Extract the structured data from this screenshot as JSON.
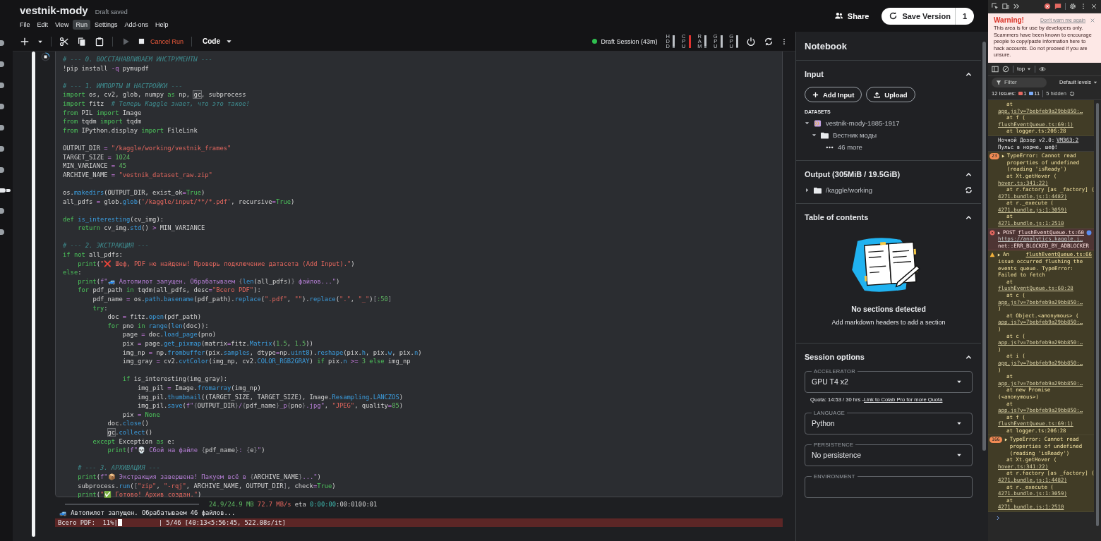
{
  "header": {
    "title": "vestnik-mody",
    "status": "Draft saved",
    "menu": [
      {
        "label": "File",
        "selected": false
      },
      {
        "label": "Edit",
        "selected": false
      },
      {
        "label": "View",
        "selected": false
      },
      {
        "label": "Run",
        "selected": true
      },
      {
        "label": "Settings",
        "selected": false
      },
      {
        "label": "Add-ons",
        "selected": false
      },
      {
        "label": "Help",
        "selected": false
      }
    ],
    "share": "Share",
    "save": "Save Version",
    "save_count": "1"
  },
  "rail": [
    {
      "selected": false
    },
    {
      "selected": false
    },
    {
      "selected": false
    },
    {
      "selected": false
    },
    {
      "selected": false
    },
    {
      "selected": false
    },
    {
      "selected": false
    },
    {
      "selected": true
    },
    {
      "selected": false
    },
    {
      "selected": false
    }
  ],
  "toolbar": {
    "cancel": "Cancel Run",
    "run_disabled": true,
    "cell_type": "Code",
    "session": "Draft Session (43m)",
    "meters": [
      {
        "label": "HDD",
        "level": 0.1
      },
      {
        "label": "CPU",
        "level": 0.95
      },
      {
        "label": "RAM",
        "level": 0.15
      },
      {
        "label": "GPU",
        "level": 0.05
      },
      {
        "label": "GPU",
        "level": 0.05
      }
    ]
  },
  "cell": {
    "running": true,
    "lines": [
      {
        "kind": "code",
        "tokens": [
          {
            "kind": "cm",
            "text": "# --- 0. ВОССТАНАВЛИВАЕМ ИНСТРУМЕНТЫ ---"
          }
        ]
      },
      {
        "kind": "code",
        "tokens": [
          {
            "kind": "pl",
            "text": "!pip install "
          },
          {
            "kind": "op",
            "text": "-q"
          },
          {
            "kind": "pl",
            "text": " pymupdf"
          }
        ]
      },
      {
        "kind": "blank"
      },
      {
        "kind": "code",
        "tokens": [
          {
            "kind": "cm",
            "text": "# --- 1. ИМПОРТЫ И НАСТРОЙКИ ---"
          }
        ]
      },
      {
        "kind": "code",
        "tokens": [
          {
            "kind": "kw",
            "text": "import"
          },
          {
            "kind": "pl",
            "text": " os, cv2, glob, numpy "
          },
          {
            "kind": "kw",
            "text": "as"
          },
          {
            "kind": "pl",
            "text": " np, "
          },
          {
            "kind": "hl",
            "text": "gc"
          },
          {
            "kind": "pl",
            "text": ", subprocess"
          }
        ]
      },
      {
        "kind": "code",
        "tokens": [
          {
            "kind": "kw",
            "text": "import"
          },
          {
            "kind": "pl",
            "text": " fitz  "
          },
          {
            "kind": "cm",
            "text": "# Теперь Kaggle знает, что это такое!"
          }
        ]
      },
      {
        "kind": "code",
        "tokens": [
          {
            "kind": "kw",
            "text": "from"
          },
          {
            "kind": "pl",
            "text": " PIL "
          },
          {
            "kind": "kw",
            "text": "import"
          },
          {
            "kind": "pl",
            "text": " Image"
          }
        ]
      },
      {
        "kind": "code",
        "tokens": [
          {
            "kind": "kw",
            "text": "from"
          },
          {
            "kind": "pl",
            "text": " tqdm "
          },
          {
            "kind": "kw",
            "text": "import"
          },
          {
            "kind": "pl",
            "text": " tqdm"
          }
        ]
      },
      {
        "kind": "code",
        "tokens": [
          {
            "kind": "kw",
            "text": "from"
          },
          {
            "kind": "pl",
            "text": " IPython.display "
          },
          {
            "kind": "kw",
            "text": "import"
          },
          {
            "kind": "pl",
            "text": " FileLink"
          }
        ]
      },
      {
        "kind": "blank"
      },
      {
        "kind": "code",
        "tokens": [
          {
            "kind": "pl",
            "text": "OUTPUT_DIR "
          },
          {
            "kind": "op",
            "text": "= "
          },
          {
            "kind": "str",
            "text": "\"/kaggle/working/vestnik_frames\""
          }
        ]
      },
      {
        "kind": "code",
        "tokens": [
          {
            "kind": "pl",
            "text": "TARGET_SIZE "
          },
          {
            "kind": "op",
            "text": "= "
          },
          {
            "kind": "num",
            "text": "1024"
          }
        ]
      },
      {
        "kind": "code",
        "tokens": [
          {
            "kind": "pl",
            "text": "MIN_VARIANCE "
          },
          {
            "kind": "op",
            "text": "= "
          },
          {
            "kind": "num",
            "text": "45"
          }
        ]
      },
      {
        "kind": "code",
        "tokens": [
          {
            "kind": "pl",
            "text": "ARCHIVE_NAME "
          },
          {
            "kind": "op",
            "text": "= "
          },
          {
            "kind": "str",
            "text": "\"vestnik_dataset_raw.zip\""
          }
        ]
      },
      {
        "kind": "blank"
      },
      {
        "kind": "code",
        "tokens": [
          {
            "kind": "pl",
            "text": "os."
          },
          {
            "kind": "fn",
            "text": "makedirs"
          },
          {
            "kind": "pl",
            "text": "(OUTPUT_DIR, exist_ok"
          },
          {
            "kind": "op",
            "text": "="
          },
          {
            "kind": "kw",
            "text": "True"
          },
          {
            "kind": "pl",
            "text": ")"
          }
        ]
      },
      {
        "kind": "code",
        "tokens": [
          {
            "kind": "pl",
            "text": "all_pdfs "
          },
          {
            "kind": "op",
            "text": "="
          },
          {
            "kind": "pl",
            "text": " glob."
          },
          {
            "kind": "fn",
            "text": "glob"
          },
          {
            "kind": "pl",
            "text": "("
          },
          {
            "kind": "str",
            "text": "'/kaggle/input/**/*.pdf'"
          },
          {
            "kind": "pl",
            "text": ", recursive"
          },
          {
            "kind": "op",
            "text": "="
          },
          {
            "kind": "kw",
            "text": "True"
          },
          {
            "kind": "pl",
            "text": ")"
          }
        ]
      },
      {
        "kind": "blank"
      },
      {
        "kind": "code",
        "tokens": [
          {
            "kind": "kw",
            "text": "def"
          },
          {
            "kind": "fn",
            "text": " is_interesting"
          },
          {
            "kind": "pl",
            "text": "(cv_img):"
          }
        ]
      },
      {
        "kind": "code",
        "tokens": [
          {
            "kind": "kw",
            "text": "    return"
          },
          {
            "kind": "pl",
            "text": " cv_img."
          },
          {
            "kind": "fn",
            "text": "std"
          },
          {
            "kind": "pl",
            "text": "() "
          },
          {
            "kind": "op",
            "text": ">"
          },
          {
            "kind": "pl",
            "text": " MIN_VARIANCE"
          }
        ]
      },
      {
        "kind": "blank"
      },
      {
        "kind": "code",
        "tokens": [
          {
            "kind": "cm",
            "text": "# --- 2. ЭКСТРАКЦИЯ ---"
          }
        ]
      },
      {
        "kind": "code",
        "tokens": [
          {
            "kind": "kw",
            "text": "if not"
          },
          {
            "kind": "pl",
            "text": " all_pdfs:"
          }
        ]
      },
      {
        "kind": "code",
        "tokens": [
          {
            "kind": "kw",
            "text": "    print"
          },
          {
            "kind": "pl",
            "text": "("
          },
          {
            "kind": "str",
            "text": "\"❌ Шеф, PDF не найдены! Проверь подключение датасета (Add Input).\""
          },
          {
            "kind": "pl",
            "text": ")"
          }
        ]
      },
      {
        "kind": "code",
        "tokens": [
          {
            "kind": "kw",
            "text": "else"
          },
          {
            "kind": "pl",
            "text": ":"
          }
        ]
      },
      {
        "kind": "code",
        "tokens": [
          {
            "kind": "kw",
            "text": "    print"
          },
          {
            "kind": "pl",
            "text": "("
          },
          {
            "kind": "fs",
            "text": "f\"🚙 Автопилот запущен. Обрабатываем "
          },
          {
            "kind": "br",
            "text": "{"
          },
          {
            "kind": "fn",
            "text": "len"
          },
          {
            "kind": "pl",
            "text": "(all_pdfs)"
          },
          {
            "kind": "br",
            "text": "}"
          },
          {
            "kind": "fs",
            "text": " файлов...\""
          },
          {
            "kind": "pl",
            "text": ")"
          }
        ]
      },
      {
        "kind": "code",
        "tokens": [
          {
            "kind": "kw",
            "text": "    for"
          },
          {
            "kind": "pl",
            "text": " pdf_path "
          },
          {
            "kind": "kw",
            "text": "in"
          },
          {
            "kind": "pl",
            "text": " tqdm(all_pdfs, desc"
          },
          {
            "kind": "op",
            "text": "="
          },
          {
            "kind": "str",
            "text": "\"Всего PDF\""
          },
          {
            "kind": "pl",
            "text": "):"
          }
        ]
      },
      {
        "kind": "code",
        "tokens": [
          {
            "kind": "pl",
            "text": "        pdf_name "
          },
          {
            "kind": "op",
            "text": "="
          },
          {
            "kind": "pl",
            "text": " os."
          },
          {
            "kind": "fn",
            "text": "path"
          },
          {
            "kind": "pl",
            "text": "."
          },
          {
            "kind": "fn",
            "text": "basename"
          },
          {
            "kind": "pl",
            "text": "(pdf_path)."
          },
          {
            "kind": "fn",
            "text": "replace"
          },
          {
            "kind": "pl",
            "text": "("
          },
          {
            "kind": "str",
            "text": "\".pdf\""
          },
          {
            "kind": "pl",
            "text": ", "
          },
          {
            "kind": "str",
            "text": "\"\""
          },
          {
            "kind": "pl",
            "text": ")."
          },
          {
            "kind": "fn",
            "text": "replace"
          },
          {
            "kind": "pl",
            "text": "("
          },
          {
            "kind": "str",
            "text": "\".\""
          },
          {
            "kind": "pl",
            "text": ", "
          },
          {
            "kind": "str",
            "text": "\"_\""
          },
          {
            "kind": "pl",
            "text": ")"
          },
          {
            "kind": "br",
            "text": "["
          },
          {
            "kind": "num",
            "text": ":50"
          },
          {
            "kind": "br",
            "text": "]"
          }
        ]
      },
      {
        "kind": "code",
        "tokens": [
          {
            "kind": "kw",
            "text": "        try"
          },
          {
            "kind": "pl",
            "text": ":"
          }
        ]
      },
      {
        "kind": "code",
        "tokens": [
          {
            "kind": "pl",
            "text": "            doc "
          },
          {
            "kind": "op",
            "text": "="
          },
          {
            "kind": "pl",
            "text": " fitz."
          },
          {
            "kind": "fn",
            "text": "open"
          },
          {
            "kind": "pl",
            "text": "(pdf_path)"
          }
        ]
      },
      {
        "kind": "code",
        "tokens": [
          {
            "kind": "kw",
            "text": "            for"
          },
          {
            "kind": "pl",
            "text": " pno "
          },
          {
            "kind": "kw",
            "text": "in"
          },
          {
            "kind": "fn",
            "text": " range"
          },
          {
            "kind": "pl",
            "text": "("
          },
          {
            "kind": "fn",
            "text": "len"
          },
          {
            "kind": "pl",
            "text": "(doc)):"
          }
        ]
      },
      {
        "kind": "code",
        "tokens": [
          {
            "kind": "pl",
            "text": "                page "
          },
          {
            "kind": "op",
            "text": "="
          },
          {
            "kind": "pl",
            "text": " doc."
          },
          {
            "kind": "fn",
            "text": "load_page"
          },
          {
            "kind": "pl",
            "text": "(pno)"
          }
        ]
      },
      {
        "kind": "code",
        "tokens": [
          {
            "kind": "pl",
            "text": "                pix "
          },
          {
            "kind": "op",
            "text": "="
          },
          {
            "kind": "pl",
            "text": " page."
          },
          {
            "kind": "fn",
            "text": "get_pixmap"
          },
          {
            "kind": "pl",
            "text": "(matrix"
          },
          {
            "kind": "op",
            "text": "="
          },
          {
            "kind": "pl",
            "text": "fitz."
          },
          {
            "kind": "fn",
            "text": "Matrix"
          },
          {
            "kind": "pl",
            "text": "("
          },
          {
            "kind": "num",
            "text": "1.5"
          },
          {
            "kind": "pl",
            "text": ", "
          },
          {
            "kind": "num",
            "text": "1.5"
          },
          {
            "kind": "pl",
            "text": "))"
          }
        ]
      },
      {
        "kind": "code",
        "tokens": [
          {
            "kind": "pl",
            "text": "                img_np "
          },
          {
            "kind": "op",
            "text": "="
          },
          {
            "kind": "pl",
            "text": " np."
          },
          {
            "kind": "fn",
            "text": "frombuffer"
          },
          {
            "kind": "pl",
            "text": "(pix."
          },
          {
            "kind": "fn",
            "text": "samples"
          },
          {
            "kind": "pl",
            "text": ", dtype"
          },
          {
            "kind": "op",
            "text": "="
          },
          {
            "kind": "pl",
            "text": "np."
          },
          {
            "kind": "fn",
            "text": "uint8"
          },
          {
            "kind": "pl",
            "text": ")."
          },
          {
            "kind": "fn",
            "text": "reshape"
          },
          {
            "kind": "pl",
            "text": "(pix."
          },
          {
            "kind": "fn",
            "text": "h"
          },
          {
            "kind": "pl",
            "text": ", pix."
          },
          {
            "kind": "fn",
            "text": "w"
          },
          {
            "kind": "pl",
            "text": ", pix."
          },
          {
            "kind": "fn",
            "text": "n"
          },
          {
            "kind": "pl",
            "text": ")"
          }
        ]
      },
      {
        "kind": "code",
        "tokens": [
          {
            "kind": "pl",
            "text": "                img_gray "
          },
          {
            "kind": "op",
            "text": "="
          },
          {
            "kind": "pl",
            "text": " cv2."
          },
          {
            "kind": "fn",
            "text": "cvtColor"
          },
          {
            "kind": "pl",
            "text": "(img_np, cv2."
          },
          {
            "kind": "fn",
            "text": "COLOR_RGB2GRAY"
          },
          {
            "kind": "pl",
            "text": ") "
          },
          {
            "kind": "kw",
            "text": "if"
          },
          {
            "kind": "pl",
            "text": " pix."
          },
          {
            "kind": "fn",
            "text": "n"
          },
          {
            "kind": "op",
            "text": " >= "
          },
          {
            "kind": "num",
            "text": "3"
          },
          {
            "kind": "kw",
            "text": " else"
          },
          {
            "kind": "pl",
            "text": " img_np"
          }
        ]
      },
      {
        "kind": "blank"
      },
      {
        "kind": "code",
        "tokens": [
          {
            "kind": "kw",
            "text": "                if"
          },
          {
            "kind": "pl",
            "text": " is_interesting(img_gray):"
          }
        ]
      },
      {
        "kind": "code",
        "tokens": [
          {
            "kind": "pl",
            "text": "                    img_pil "
          },
          {
            "kind": "op",
            "text": "="
          },
          {
            "kind": "pl",
            "text": " Image."
          },
          {
            "kind": "fn",
            "text": "fromarray"
          },
          {
            "kind": "pl",
            "text": "(img_np)"
          }
        ]
      },
      {
        "kind": "code",
        "tokens": [
          {
            "kind": "pl",
            "text": "                    img_pil."
          },
          {
            "kind": "fn",
            "text": "thumbnail"
          },
          {
            "kind": "pl",
            "text": "((TARGET_SIZE, TARGET_SIZE), Image."
          },
          {
            "kind": "fn",
            "text": "Resampling"
          },
          {
            "kind": "pl",
            "text": "."
          },
          {
            "kind": "fn",
            "text": "LANCZOS"
          },
          {
            "kind": "pl",
            "text": ")"
          }
        ]
      },
      {
        "kind": "code",
        "tokens": [
          {
            "kind": "pl",
            "text": "                    img_pil."
          },
          {
            "kind": "fn",
            "text": "save"
          },
          {
            "kind": "pl",
            "text": "("
          },
          {
            "kind": "fs",
            "text": "f\""
          },
          {
            "kind": "br",
            "text": "{"
          },
          {
            "kind": "pl",
            "text": "OUTPUT_DIR"
          },
          {
            "kind": "br",
            "text": "}"
          },
          {
            "kind": "fs",
            "text": "/"
          },
          {
            "kind": "br",
            "text": "{"
          },
          {
            "kind": "pl",
            "text": "pdf_name"
          },
          {
            "kind": "br",
            "text": "}"
          },
          {
            "kind": "fs",
            "text": "_p"
          },
          {
            "kind": "br",
            "text": "{"
          },
          {
            "kind": "pl",
            "text": "pno"
          },
          {
            "kind": "br",
            "text": "}"
          },
          {
            "kind": "fs",
            "text": ".jpg\""
          },
          {
            "kind": "pl",
            "text": ", "
          },
          {
            "kind": "str",
            "text": "\"JPEG\""
          },
          {
            "kind": "pl",
            "text": ", quality"
          },
          {
            "kind": "op",
            "text": "="
          },
          {
            "kind": "num",
            "text": "85"
          },
          {
            "kind": "pl",
            "text": ")"
          }
        ]
      },
      {
        "kind": "code",
        "tokens": [
          {
            "kind": "pl",
            "text": "                pix "
          },
          {
            "kind": "op",
            "text": "= "
          },
          {
            "kind": "kw",
            "text": "None"
          }
        ]
      },
      {
        "kind": "code",
        "tokens": [
          {
            "kind": "pl",
            "text": "            doc."
          },
          {
            "kind": "fn",
            "text": "close"
          },
          {
            "kind": "pl",
            "text": "()"
          }
        ]
      },
      {
        "kind": "code",
        "tokens": [
          {
            "kind": "hl",
            "text": "            gc"
          },
          {
            "kind": "pl",
            "text": "."
          },
          {
            "kind": "fn",
            "text": "collect"
          },
          {
            "kind": "pl",
            "text": "()"
          }
        ]
      },
      {
        "kind": "code",
        "tokens": [
          {
            "kind": "kw",
            "text": "        except"
          },
          {
            "kind": "pl",
            "text": " Exception "
          },
          {
            "kind": "kw",
            "text": "as"
          },
          {
            "kind": "pl",
            "text": " e:"
          }
        ]
      },
      {
        "kind": "code",
        "tokens": [
          {
            "kind": "kw",
            "text": "            print"
          },
          {
            "kind": "pl",
            "text": "("
          },
          {
            "kind": "fs",
            "text": "f\"💀 Сбой на файле "
          },
          {
            "kind": "br",
            "text": "{"
          },
          {
            "kind": "pl",
            "text": "pdf_name"
          },
          {
            "kind": "br",
            "text": "}"
          },
          {
            "kind": "fs",
            "text": ": "
          },
          {
            "kind": "br",
            "text": "{"
          },
          {
            "kind": "pl",
            "text": "e"
          },
          {
            "kind": "br",
            "text": "}"
          },
          {
            "kind": "fs",
            "text": "\""
          },
          {
            "kind": "pl",
            "text": ")"
          }
        ]
      },
      {
        "kind": "blank"
      },
      {
        "kind": "code",
        "tokens": [
          {
            "kind": "cm",
            "text": "    # --- 3. АРХИВАЦИЯ ---"
          }
        ]
      },
      {
        "kind": "code",
        "tokens": [
          {
            "kind": "kw",
            "text": "    print"
          },
          {
            "kind": "pl",
            "text": "("
          },
          {
            "kind": "fs",
            "text": "f\"📦 Экстракция завершена! Пакуем всё в "
          },
          {
            "kind": "br",
            "text": "{"
          },
          {
            "kind": "pl",
            "text": "ARCHIVE_NAME"
          },
          {
            "kind": "br",
            "text": "}"
          },
          {
            "kind": "fs",
            "text": "...\""
          },
          {
            "kind": "pl",
            "text": ")"
          }
        ]
      },
      {
        "kind": "code",
        "tokens": [
          {
            "kind": "pl",
            "text": "    subprocess."
          },
          {
            "kind": "fn",
            "text": "run"
          },
          {
            "kind": "pl",
            "text": "("
          },
          {
            "kind": "br",
            "text": "["
          },
          {
            "kind": "str",
            "text": "\"zip\""
          },
          {
            "kind": "pl",
            "text": ", "
          },
          {
            "kind": "str",
            "text": "\"-rqj\""
          },
          {
            "kind": "pl",
            "text": ", ARCHIVE_NAME, OUTPUT_DIR"
          },
          {
            "kind": "br",
            "text": "]"
          },
          {
            "kind": "pl",
            "text": ", check"
          },
          {
            "kind": "op",
            "text": "="
          },
          {
            "kind": "kw",
            "text": "True"
          },
          {
            "kind": "pl",
            "text": ")"
          }
        ]
      },
      {
        "kind": "code",
        "tokens": [
          {
            "kind": "kw",
            "text": "    print"
          },
          {
            "kind": "pl",
            "text": "("
          },
          {
            "kind": "str",
            "text": "\"✅ Готово! Архив создан.\""
          },
          {
            "kind": "pl",
            "text": ")"
          }
        ]
      }
    ],
    "output": {
      "download": {
        "level": 1.0,
        "tokens": [
          {
            "kind": "size",
            "text": "24.9/24.9 MB"
          },
          {
            "kind": "speed",
            "text": " 72.7 MB/s"
          },
          {
            "kind": "pl",
            "text": " eta "
          },
          {
            "kind": "eta",
            "text": "0:00:00"
          },
          {
            "kind": "pl",
            "text": ":00:0100:01"
          }
        ]
      },
      "log": "🚙 Автопилот запущен. Обрабатываем 46 файлов...",
      "progress": {
        "prefix": "Всего PDF:  11%|",
        "level": 0.11,
        "suffix": "| 5/46 [40:13<5:56:45, 522.08s/it]"
      }
    }
  },
  "panel": {
    "title": "Notebook",
    "input": {
      "title": "Input",
      "expanded": true,
      "buttons": [
        "Add Input",
        "Upload"
      ],
      "datasets_label": "DATASETS",
      "tree": [
        {
          "label": "vestnik-mody-1885-1917",
          "kind": "dataset",
          "expanded": true,
          "children": [
            {
              "label": "Вестник моды",
              "kind": "folder",
              "expanded": true,
              "children": [
                {
                  "label": "46 more",
                  "kind": "more"
                }
              ]
            }
          ]
        }
      ]
    },
    "output": {
      "title": "Output (305MiB / 19.5GiB)",
      "expanded": true,
      "tree": [
        {
          "label": "/kaggle/working",
          "kind": "folder",
          "expanded": false
        }
      ]
    },
    "toc": {
      "title": "Table of contents",
      "expanded": true,
      "empty_title": "No sections detected",
      "empty_text": "Add markdown headers to add a section"
    },
    "session": {
      "title": "Session options",
      "expanded": true,
      "fields": [
        {
          "label": "ACCELERATOR",
          "value": "GPU T4 x2",
          "note": "Quota: 14:53 / 30 hrs - ",
          "note_link": "Link to Colab Pro for more Quota"
        },
        {
          "label": "LANGUAGE",
          "value": "Python"
        },
        {
          "label": "PERSISTENCE",
          "value": "No persistence"
        },
        {
          "label": "ENVIRONMENT"
        }
      ]
    }
  },
  "devtools": {
    "warning": {
      "title": "Warning!",
      "dismiss": "Don't warn me again",
      "text": "This area is for use by developers only. Scammers have been known to encourage people to copy/paste information here to hack accounts. Do not proceed if you are unsure."
    },
    "context": "top",
    "filter_placeholder": "Filter",
    "levels": "Default levels",
    "issues": {
      "label": "12 Issues:",
      "errors": "1",
      "infos": "11",
      "hidden": "5 hidden"
    },
    "messages": [
      {
        "kind": "warning",
        "lines": [
          {
            "kind": "at",
            "text": "at"
          },
          {
            "kind": "link",
            "text": "app.js?v=7bebfeb9a29bb850:…"
          },
          {
            "kind": "at",
            "text": "at f ("
          },
          {
            "kind": "link",
            "text": "flushEventQueue.ts:69:1)"
          },
          {
            "kind": "at",
            "text": "at logger.ts:206:28"
          }
        ]
      },
      {
        "kind": "info",
        "head": "Ночной Дозор v2.0:",
        "source": "VM363:2",
        "text": "Пульс в норме, шеф!"
      },
      {
        "kind": "warning",
        "count": "23",
        "head": "TypeError: Cannot read properties of undefined (reading 'isReady')",
        "lines": [
          {
            "kind": "at",
            "text": "at Xt.getHover ("
          },
          {
            "kind": "link",
            "text": "hover.ts:341:22)"
          },
          {
            "kind": "at",
            "text": "at r.factory [as _factory] ("
          },
          {
            "kind": "link",
            "text": "4271.bundle.js:1:4482)"
          },
          {
            "kind": "at",
            "text": "at r._execute ("
          },
          {
            "kind": "link",
            "text": "4271.bundle.js:1:3059)"
          },
          {
            "kind": "at",
            "text": "at"
          },
          {
            "kind": "link",
            "text": "4271.bundle.js:1:2510"
          }
        ]
      },
      {
        "kind": "error",
        "head": "POST",
        "source": "flushEventQueue.ts:60",
        "lines": [
          {
            "kind": "link",
            "text": "https://analytics.kaggle.i…"
          },
          {
            "kind": "text",
            "text": "net::ERR_BLOCKED_BY_ADBLOCKER"
          }
        ]
      },
      {
        "kind": "warning",
        "head": "An",
        "source": "flushEventQueue.ts:66",
        "text": "issue occurred flushing the events queue. TypeError: Failed to fetch",
        "lines": [
          {
            "kind": "at",
            "text": "at"
          },
          {
            "kind": "link",
            "text": "flushEventQueue.ts:60:28"
          },
          {
            "kind": "at",
            "text": "at c ("
          },
          {
            "kind": "link",
            "text": "app.js?v=7bebfeb9a29bb850:…"
          },
          {
            "kind": "text",
            "text": ")"
          },
          {
            "kind": "at",
            "text": "at Object.<anonymous> ("
          },
          {
            "kind": "link",
            "text": "app.js?v=7bebfeb9a29bb850:…"
          },
          {
            "kind": "text",
            "text": ")"
          },
          {
            "kind": "at",
            "text": "at c ("
          },
          {
            "kind": "link",
            "text": "app.js?v=7bebfeb9a29bb850:…"
          },
          {
            "kind": "text",
            "text": ")"
          },
          {
            "kind": "at",
            "text": "at i ("
          },
          {
            "kind": "link",
            "text": "app.js?v=7bebfeb9a29bb850:…"
          },
          {
            "kind": "text",
            "text": ")"
          },
          {
            "kind": "at",
            "text": "at"
          },
          {
            "kind": "link",
            "text": "app.js?v=7bebfeb9a29bb850:…"
          },
          {
            "kind": "at",
            "text": "at new Promise"
          },
          {
            "kind": "text",
            "text": "(<anonymous>)"
          },
          {
            "kind": "at",
            "text": "at"
          },
          {
            "kind": "link",
            "text": "app.js?v=7bebfeb9a29bb850:…"
          },
          {
            "kind": "at",
            "text": "at f ("
          },
          {
            "kind": "link",
            "text": "flushEventQueue.ts:69:1)"
          },
          {
            "kind": "at",
            "text": "at logger.ts:206:28"
          }
        ]
      },
      {
        "kind": "warning",
        "count": "166",
        "head": "TypeError: Cannot read properties of undefined (reading 'isReady')",
        "lines": [
          {
            "kind": "at",
            "text": "at Xt.getHover ("
          },
          {
            "kind": "link",
            "text": "hover.ts:341:22)"
          },
          {
            "kind": "at",
            "text": "at r.factory [as _factory] ("
          },
          {
            "kind": "link",
            "text": "4271.bundle.js:1:4482)"
          },
          {
            "kind": "at",
            "text": "at r._execute ("
          },
          {
            "kind": "link",
            "text": "4271.bundle.js:1:3059)"
          },
          {
            "kind": "at",
            "text": "at"
          },
          {
            "kind": "link",
            "text": "4271.bundle.js:1:2510"
          }
        ]
      }
    ]
  }
}
